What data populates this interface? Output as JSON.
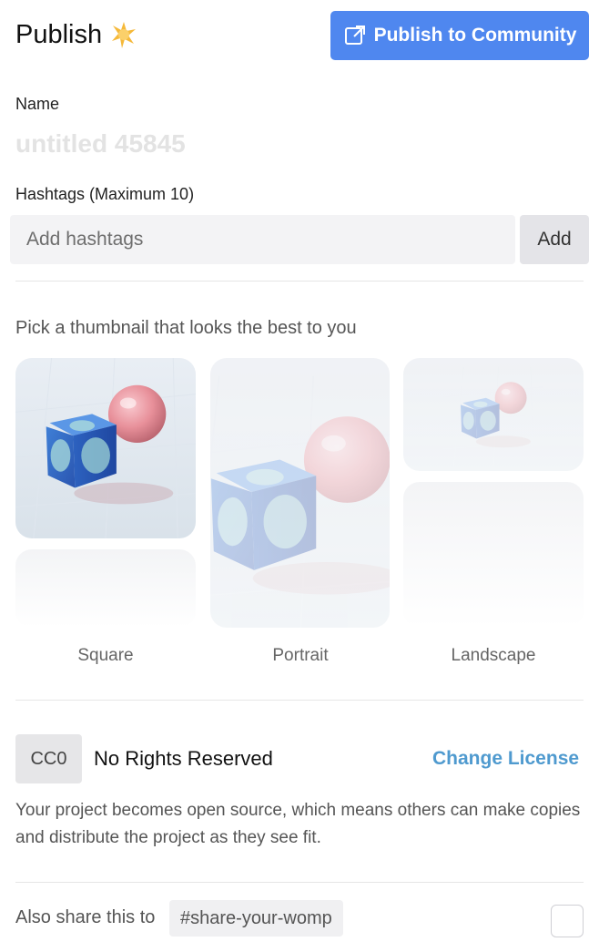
{
  "header": {
    "title": "Publish",
    "publish_button_label": "Publish to Community",
    "accent_color": "#4f87ef"
  },
  "name_field": {
    "label": "Name",
    "placeholder": "untitled 45845"
  },
  "hashtags": {
    "label": "Hashtags (Maximum 10)",
    "placeholder": "Add hashtags",
    "add_button_label": "Add"
  },
  "thumbnails": {
    "prompt": "Pick a thumbnail that looks the best to you",
    "options": [
      {
        "label": "Square",
        "selected": true
      },
      {
        "label": "Portrait",
        "selected": false
      },
      {
        "label": "Landscape",
        "selected": false
      }
    ]
  },
  "license": {
    "badge": "CC0",
    "name": "No Rights Reserved",
    "change_link": "Change License",
    "description": "Your project becomes open source, which means others can make copies and distribute the project as they see fit.",
    "link_color": "#4f9acf"
  },
  "share": {
    "text": "Also share this to",
    "channel": "#share-your-womp",
    "checked": false
  },
  "icons": {
    "title_icon": "sparkle-icon",
    "publish_icon": "external-link-icon"
  }
}
